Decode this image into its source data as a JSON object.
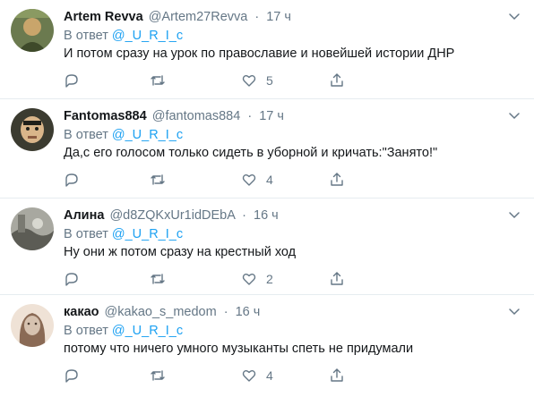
{
  "reply_prefix": "В ответ",
  "tweets": [
    {
      "name": "Artem Revva",
      "handle": "@Artem27Revva",
      "dot": "·",
      "time": "17 ч",
      "reply_to": "@_U_R_I_c",
      "text": "И потом сразу на урок по православие и новейшей истории ДНР",
      "likes": "5",
      "avatar_colors": [
        "#6b7a4f",
        "#c9a56b",
        "#3e4a2a"
      ]
    },
    {
      "name": "Fantomas884",
      "handle": "@fantomas884",
      "dot": "·",
      "time": "17 ч",
      "reply_to": "@_U_R_I_c",
      "text": "Да,с его голосом только сидеть в уборной и кричать:\"Занято!\"",
      "likes": "4",
      "avatar_colors": [
        "#3b3b30",
        "#d9b58a",
        "#1f1f1a"
      ]
    },
    {
      "name": "Алина",
      "handle": "@d8ZQKxUr1idDEbA",
      "dot": "·",
      "time": "16 ч",
      "reply_to": "@_U_R_I_c",
      "text": "Ну они ж потом сразу на крестный ход",
      "likes": "2",
      "avatar_colors": [
        "#a8a8a0",
        "#5c5c55",
        "#d8d8d0"
      ]
    },
    {
      "name": "какао",
      "handle": "@kakao_s_medom",
      "dot": "·",
      "time": "16 ч",
      "reply_to": "@_U_R_I_c",
      "text": "потому что ничего умного музыканты спеть не придумали",
      "likes": "4",
      "avatar_colors": [
        "#d6c2b0",
        "#8a6a55",
        "#efe2d6"
      ]
    }
  ]
}
